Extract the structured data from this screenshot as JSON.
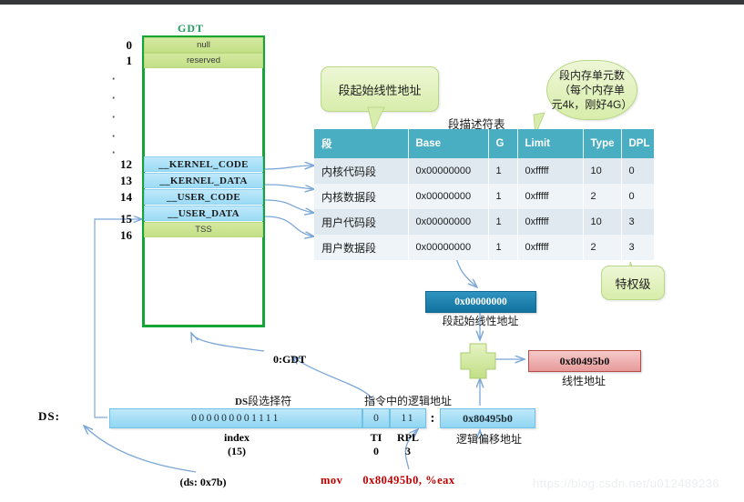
{
  "gdt": {
    "title": "GDT",
    "entries": [
      {
        "index": "0",
        "label": "null",
        "style": "green"
      },
      {
        "index": "1",
        "label": "reserved",
        "style": "green"
      },
      {
        "index": "12",
        "label": "__KERNEL_CODE",
        "style": "blue"
      },
      {
        "index": "13",
        "label": "__KERNEL_DATA",
        "style": "blue"
      },
      {
        "index": "14",
        "label": "__USER_CODE",
        "style": "blue"
      },
      {
        "index": "15",
        "label": "__USER_DATA",
        "style": "blue"
      },
      {
        "index": "16",
        "label": "TSS",
        "style": "green"
      }
    ],
    "ellipsis": [
      "·",
      "·",
      "·",
      "·",
      "·"
    ]
  },
  "callouts": {
    "base": "段起始线性地址",
    "limit": "段内存单元数\n（每个内存单\n元4k，刚好4G）",
    "dpl": "特权级"
  },
  "descriptor_table": {
    "title": "段描述符表",
    "headers": [
      "段",
      "Base",
      "G",
      "Limit",
      "Type",
      "DPL"
    ],
    "rows": [
      [
        "内核代码段",
        "0x00000000",
        "1",
        "0xfffff",
        "10",
        "0"
      ],
      [
        "内核数据段",
        "0x00000000",
        "1",
        "0xfffff",
        "2",
        "0"
      ],
      [
        "用户代码段",
        "0x00000000",
        "1",
        "0xfffff",
        "10",
        "3"
      ],
      [
        "用户数据段",
        "0x00000000",
        "1",
        "0xfffff",
        "2",
        "3"
      ]
    ]
  },
  "flow": {
    "seg_base_value": "0x00000000",
    "seg_base_caption": "段起始线性地址",
    "plus_sign": "+",
    "linear_value": "0x80495b0",
    "linear_caption": "线性地址"
  },
  "selector": {
    "ds_label": "DS:",
    "index_bits": "000000001111",
    "ti_bits": "0",
    "rpl_bits": "11",
    "separator": ":",
    "offset_value": "0x80495b0",
    "label_index": "index",
    "label_index_value": "(15)",
    "label_ti": "TI",
    "label_ti_value": "0",
    "label_rpl": "RPL",
    "label_rpl_value": "3",
    "caption_ds_selector_prefix": "DS",
    "caption_ds_selector": "段选择符",
    "caption_logical_addr": "指令中的逻辑地址",
    "caption_offset": "逻辑偏移地址",
    "note_ds_value": "(ds: 0x7b)",
    "note_ti_gdt": "0:GDT"
  },
  "instruction": {
    "opcode": "mov",
    "operands": "0x80495b0, %eax"
  },
  "watermark": "https://blog.csdn.net/u012489236",
  "colors": {
    "gdt_border": "#13a538",
    "gdt_title": "#1f9a5c",
    "table_header": "#4aaec2",
    "callout_fill": "#d8edab",
    "blue_box": "#12729f",
    "red_box": "#e79a9a",
    "arrow": "#7ba7d7",
    "instruction": "#c00000"
  }
}
